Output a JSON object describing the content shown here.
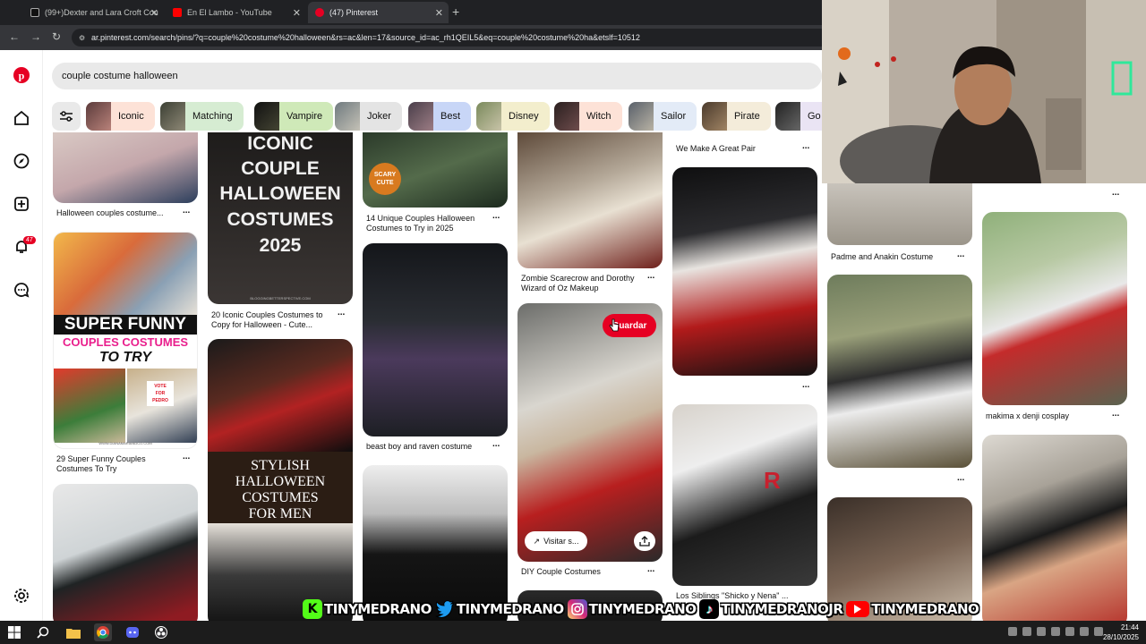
{
  "browser": {
    "tabs": [
      {
        "title": "(99+)Dexter and Lara Croft Cou",
        "favicon_color": "#111111"
      },
      {
        "title": "En El Lambo - YouTube",
        "favicon_color": "#ff0000"
      },
      {
        "title": "(47) Pinterest",
        "favicon_color": "#e60023"
      }
    ],
    "new_tab": "+",
    "url": "ar.pinterest.com/search/pins/?q=couple%20costume%20halloween&rs=ac&len=17&source_id=ac_rh1QEIL5&eq=couple%20costume%20ha&etslf=10512"
  },
  "sidebar": {
    "notification_count": "47",
    "icons": [
      "pinterest-logo",
      "home-icon",
      "explore-icon",
      "create-icon",
      "bell-icon",
      "messages-icon",
      "settings-icon"
    ]
  },
  "search": {
    "query": "couple costume halloween"
  },
  "chips": [
    {
      "label": "Iconic",
      "color": "#fde2d7"
    },
    {
      "label": "Matching",
      "color": "#d6ecd2"
    },
    {
      "label": "Vampire",
      "color": "#cfe9b8"
    },
    {
      "label": "Joker",
      "color": "#e4e4e4"
    },
    {
      "label": "Best",
      "color": "#c8d6f7"
    },
    {
      "label": "Disney",
      "color": "#f3eecd"
    },
    {
      "label": "Witch",
      "color": "#fde2d7"
    },
    {
      "label": "Sailor",
      "color": "#e3ebf7"
    },
    {
      "label": "Pirate",
      "color": "#f4ecda"
    },
    {
      "label": "Go",
      "color": "#eae4f4"
    }
  ],
  "pins": {
    "titles": [
      "Halloween couples costume...",
      "29 Super Funny Couples Costumes To Try",
      "20 Iconic Couples Costumes to Copy for Halloween - Cute...",
      "14 Unique Couples Halloween Costumes to Try in 2025",
      "beast boy and raven costume",
      "Zombie Scarecrow and Dorothy Wizard of Oz Makeup",
      "DIY Couple Costumes",
      "We Make A Great Pair",
      "Los Siblings \"Shicko y Nena\" ...",
      "Padme and Anakin Costume",
      "makima x denji cosplay"
    ],
    "overlay_text": {
      "iconic_1": "ICONIC",
      "iconic_2": "COUPLE",
      "iconic_3": "HALLOWEEN",
      "iconic_4": "COSTUMES",
      "iconic_5": "2025",
      "funny_1": "SUPER FUNNY",
      "funny_2": "COUPLES COSTUMES",
      "funny_3": "TO TRY",
      "funny_shirt_1": "VOTE",
      "funny_shirt_2": "FOR",
      "funny_shirt_3": "PEDRO",
      "funny_site": "WWW.DIANAMARIANDCO.COM",
      "stylish_1": "STYLISH",
      "stylish_2": "HALLOWEEN",
      "stylish_3": "COSTUMES",
      "stylish_4": "FOR MEN",
      "scary_1": "SCARY",
      "scary_2": "CUTE",
      "blog": "BLOGGINGBETTERSPECTIVE.COM",
      "rocket_letter": "R"
    },
    "save_label": "Guardar",
    "visit_label": "Visitar s...",
    "more": "..."
  },
  "social": [
    {
      "network": "kick",
      "handle": "TINYMEDRANO",
      "color": "#53fc18"
    },
    {
      "network": "twitter",
      "handle": "TINYMEDRANO",
      "color": "#1d9bf0"
    },
    {
      "network": "instagram",
      "handle": "TINYMEDRANO",
      "color": "#d62976"
    },
    {
      "network": "tiktok",
      "handle": "TINYMEDRANOJR",
      "color": "#000000"
    },
    {
      "network": "youtube",
      "handle": "TINYMEDRANO",
      "color": "#ff0000"
    }
  ],
  "taskbar": {
    "time": "21:44",
    "date": "28/10/2025"
  }
}
